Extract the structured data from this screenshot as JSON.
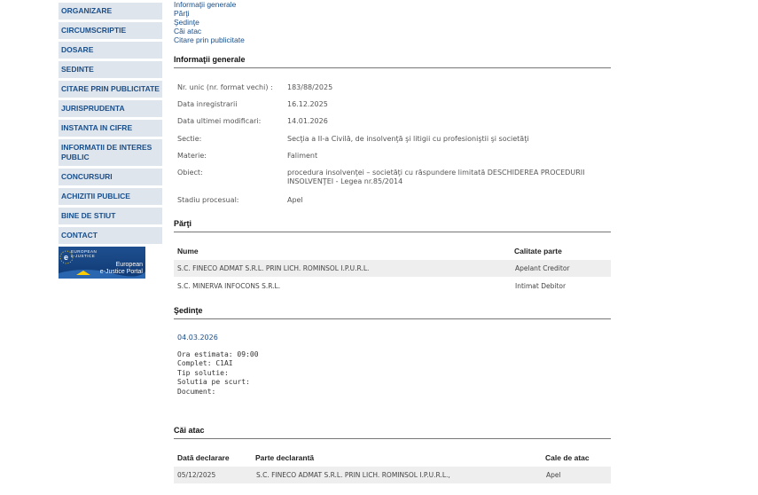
{
  "sidebar": {
    "items": [
      {
        "label": "ORGANIZARE"
      },
      {
        "label": "CIRCUMSCRIPTIE"
      },
      {
        "label": "DOSARE"
      },
      {
        "label": "SEDINTE"
      },
      {
        "label": "CITARE PRIN PUBLICITATE"
      },
      {
        "label": "JURISPRUDENTA"
      },
      {
        "label": "INSTANTA IN CIFRE"
      },
      {
        "label": "INFORMATII DE INTERES PUBLIC"
      },
      {
        "label": "CONCURSURI"
      },
      {
        "label": "ACHIZITII PUBLICE"
      },
      {
        "label": "BINE DE STIUT"
      },
      {
        "label": "CONTACT"
      }
    ],
    "banner": {
      "line1": "European",
      "line2": "e-Justice Portal",
      "small1": "EUROPEAN",
      "small2": "e-JUSTICE"
    }
  },
  "toplinks": [
    "Informaţii generale",
    "Părţi",
    "Şedinţe",
    "Căi atac",
    "Citare prin publicitate"
  ],
  "info": {
    "title": "Informaţii generale",
    "rows": [
      {
        "label": "Nr. unic (nr. format vechi) :",
        "value": "183/88/2025"
      },
      {
        "label": "Data inregistrarii",
        "value": "16.12.2025"
      },
      {
        "label": "Data ultimei modificari:",
        "value": "14.01.2026"
      },
      {
        "label": "Sectie:",
        "value": "Secţia a II-a Civilă, de insolvenţă şi litigii cu profesioniştii şi societăţi"
      },
      {
        "label": "Materie:",
        "value": "Faliment"
      },
      {
        "label": "Obiect:",
        "value": "procedura insolvenţei – societăţi cu răspundere limitată DESCHIDEREA PROCEDURII INSOLVENŢEI - Legea nr.85/2014"
      },
      {
        "label": "Stadiu procesual:",
        "value": "Apel"
      }
    ]
  },
  "parti": {
    "title": "Părţi",
    "headers": {
      "name": "Nume",
      "role": "Calitate parte"
    },
    "rows": [
      {
        "name": "S.C. FINECO ADMAT S.R.L. PRIN LICH. ROMINSOL I.P.U.R.L.",
        "role": "Apelant Creditor"
      },
      {
        "name": "S.C. MINERVA INFOCONS S.R.L.",
        "role": "Intimat Debitor"
      }
    ]
  },
  "sedinte": {
    "title": "Şedinţe",
    "date": "04.03.2026",
    "details": [
      "Ora estimata: 09:00",
      "Complet: C1AI",
      "Tip solutie:",
      "Solutia pe scurt:",
      "Document:"
    ]
  },
  "caiatac": {
    "title": "Căi atac",
    "headers": {
      "date": "Dată declarare",
      "party": "Parte declarantă",
      "type": "Cale de atac"
    },
    "rows": [
      {
        "date": "05/12/2025",
        "party": "S.C. FINECO ADMAT S.R.L. PRIN LICH. ROMINSOL I.P.U.R.L.,",
        "type": "Apel"
      }
    ]
  }
}
